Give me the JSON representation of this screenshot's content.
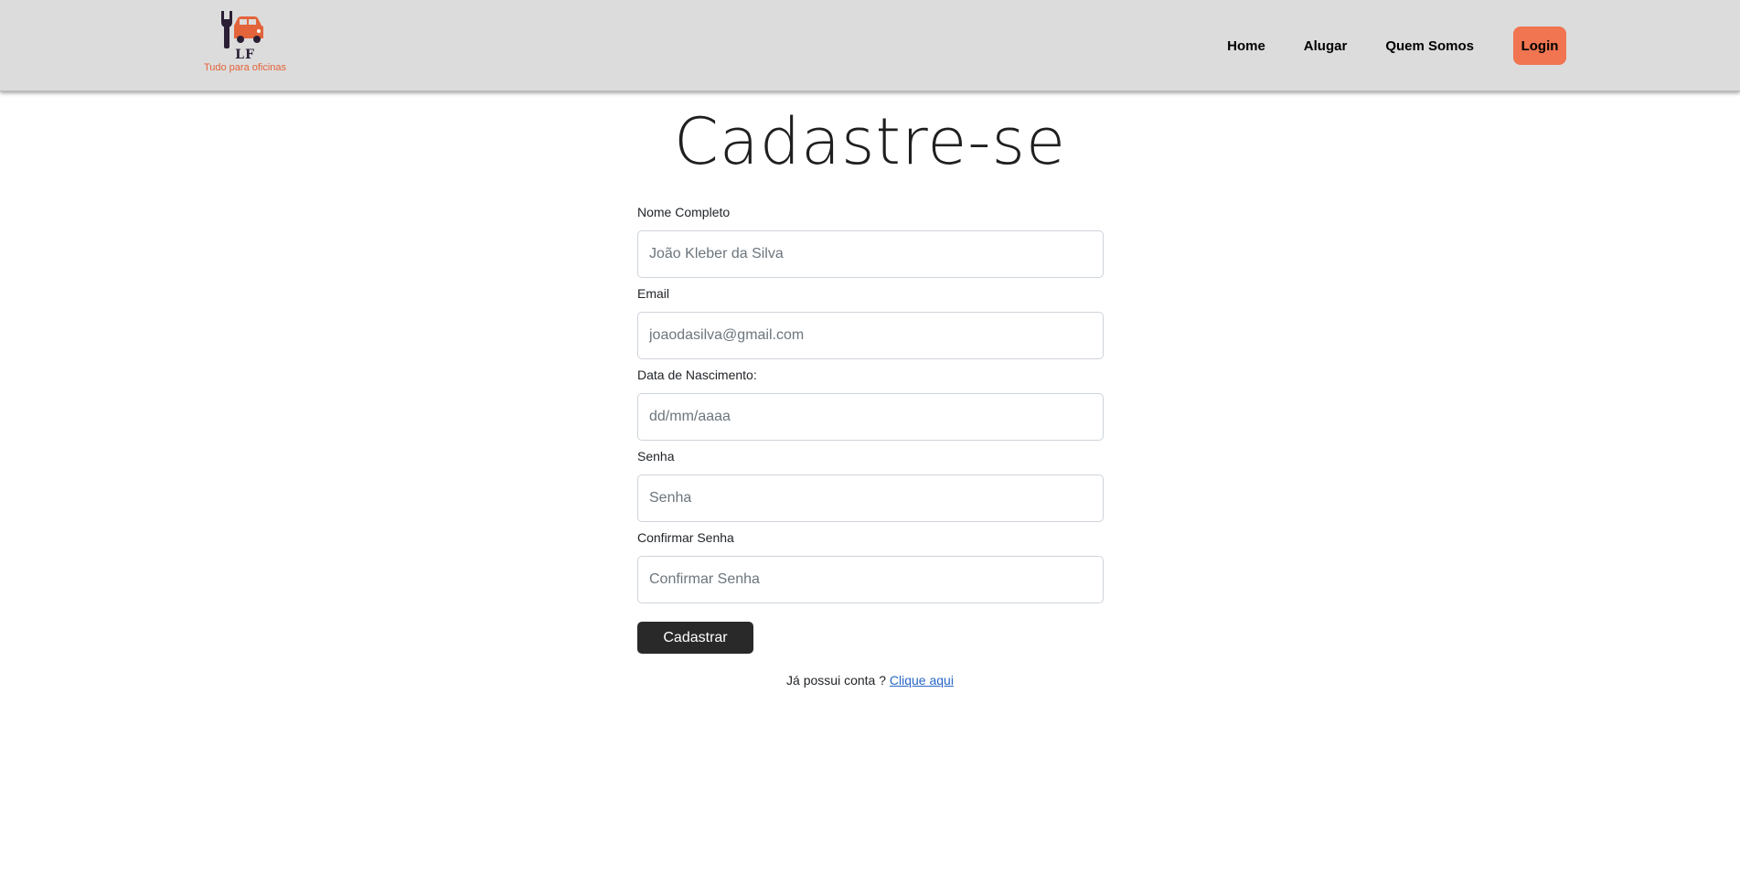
{
  "header": {
    "logo": {
      "letters": "LF",
      "tagline": "Tudo para oficinas",
      "icon": "wrench-car-icon",
      "colors": {
        "wrench": "#2a1f34",
        "car": "#e3643a"
      }
    },
    "nav": {
      "home": "Home",
      "rent": "Alugar",
      "about": "Quem Somos",
      "login": "Login"
    },
    "colors": {
      "background": "#dcdcdc",
      "login_button": "#f07550"
    }
  },
  "page": {
    "title": "Cadastre-se"
  },
  "form": {
    "fields": [
      {
        "label": "Nome Completo",
        "placeholder": "João Kleber da Silva",
        "value": ""
      },
      {
        "label": "Email",
        "placeholder": "joaodasilva@gmail.com",
        "value": ""
      },
      {
        "label": "Data de Nascimento:",
        "placeholder": "dd/mm/aaaa",
        "value": ""
      },
      {
        "label": "Senha",
        "placeholder": "Senha",
        "value": ""
      },
      {
        "label": "Confirmar Senha",
        "placeholder": "Confirmar Senha",
        "value": ""
      }
    ],
    "submit_label": "Cadastrar",
    "submit_color": "#292929"
  },
  "footer_hint": {
    "text": "Já possui conta ?",
    "link": "Clique aqui",
    "link_color": "#2866c7"
  }
}
